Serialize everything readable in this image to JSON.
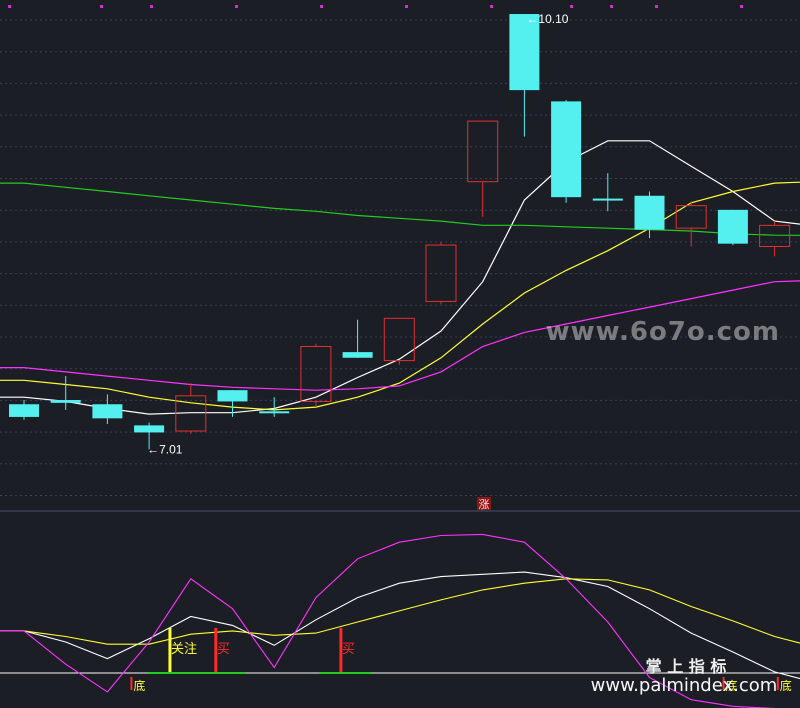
{
  "chart_data": {
    "type": "candlestick",
    "price_annotations": {
      "high_label": "10.10",
      "low_label": "7.01"
    },
    "price_panel": {
      "ylim": [
        6.7,
        10.15
      ],
      "candles": [
        {
          "open": 7.33,
          "high": 7.36,
          "low": 7.22,
          "close": 7.24
        },
        {
          "open": 7.36,
          "high": 7.53,
          "low": 7.29,
          "close": 7.34
        },
        {
          "open": 7.33,
          "high": 7.4,
          "low": 7.19,
          "close": 7.23
        },
        {
          "open": 7.18,
          "high": 7.2,
          "low": 7.01,
          "close": 7.13
        },
        {
          "open": 7.14,
          "high": 7.48,
          "low": 7.12,
          "close": 7.39
        },
        {
          "open": 7.43,
          "high": 7.43,
          "low": 7.24,
          "close": 7.35
        },
        {
          "open": 7.28,
          "high": 7.38,
          "low": 7.24,
          "close": 7.27
        },
        {
          "open": 7.35,
          "high": 7.76,
          "low": 7.31,
          "close": 7.74
        },
        {
          "open": 7.7,
          "high": 7.93,
          "low": 7.66,
          "close": 7.66
        },
        {
          "open": 7.64,
          "high": 7.94,
          "low": 7.61,
          "close": 7.94
        },
        {
          "open": 8.06,
          "high": 8.48,
          "low": 8.04,
          "close": 8.46
        },
        {
          "open": 8.91,
          "high": 9.34,
          "low": 8.66,
          "close": 9.34
        },
        {
          "open": 10.1,
          "high": 10.1,
          "low": 9.23,
          "close": 9.56
        },
        {
          "open": 9.48,
          "high": 9.49,
          "low": 8.76,
          "close": 8.8
        },
        {
          "open": 8.79,
          "high": 8.97,
          "low": 8.7,
          "close": 8.79
        },
        {
          "open": 8.81,
          "high": 8.84,
          "low": 8.51,
          "close": 8.57
        },
        {
          "open": 8.58,
          "high": 8.77,
          "low": 8.45,
          "close": 8.74
        },
        {
          "open": 8.71,
          "high": 8.71,
          "low": 8.46,
          "close": 8.47
        },
        {
          "open": 8.45,
          "high": 8.63,
          "low": 8.38,
          "close": 8.6
        }
      ],
      "moving_averages": [
        {
          "color": "#ffffff",
          "values": [
            7.38,
            7.35,
            7.3,
            7.26,
            7.27,
            7.27,
            7.3,
            7.38,
            7.52,
            7.65,
            7.85,
            8.2,
            8.78,
            9.05,
            9.2,
            9.2,
            9.02,
            8.84,
            8.63
          ]
        },
        {
          "color": "#ffff33",
          "values": [
            7.5,
            7.47,
            7.44,
            7.38,
            7.34,
            7.31,
            7.29,
            7.31,
            7.38,
            7.48,
            7.66,
            7.9,
            8.12,
            8.28,
            8.42,
            8.58,
            8.76,
            8.84,
            8.9
          ]
        },
        {
          "color": "#ff33ff",
          "values": [
            7.59,
            7.56,
            7.53,
            7.5,
            7.47,
            7.45,
            7.44,
            7.43,
            7.44,
            7.46,
            7.56,
            7.74,
            7.84,
            7.9,
            7.96,
            8.02,
            8.08,
            8.14,
            8.2
          ]
        },
        {
          "color": "#22cc22",
          "values": [
            8.9,
            8.87,
            8.84,
            8.81,
            8.78,
            8.75,
            8.72,
            8.7,
            8.67,
            8.65,
            8.63,
            8.6,
            8.6,
            8.59,
            8.58,
            8.57,
            8.56,
            8.54,
            8.53
          ]
        }
      ]
    },
    "indicator_panel": {
      "ylim": [
        -10,
        155
      ],
      "lines": [
        {
          "color": "#ffffff",
          "values": [
            55,
            45,
            30,
            48,
            68,
            60,
            42,
            65,
            85,
            98,
            104,
            106,
            108,
            103,
            95,
            75,
            53,
            36,
            18
          ]
        },
        {
          "color": "#ffff33",
          "values": [
            55,
            50,
            43,
            43,
            52,
            55,
            51,
            53,
            63,
            73,
            83,
            92,
            98,
            102,
            101,
            92,
            77,
            64,
            50
          ]
        },
        {
          "color": "#ff33ff",
          "values": [
            55,
            25,
            0,
            45,
            102,
            75,
            22,
            85,
            120,
            135,
            141,
            142,
            135,
            102,
            63,
            13,
            -7,
            -13,
            -15
          ]
        }
      ],
      "bottom_markers": [
        {
          "text": "底",
          "index": 2.6
        },
        {
          "text": "底",
          "index": 16.8
        },
        {
          "text": "底",
          "index": 18.1
        },
        {
          "text": "底",
          "index": 19.0
        }
      ],
      "signal_markers": [
        {
          "text": "关注",
          "index": 3.5,
          "color": "#ffff33"
        },
        {
          "text": "买",
          "index": 4.6,
          "color": "#ff2a2a"
        },
        {
          "text": "买",
          "index": 7.6,
          "color": "#ff2a2a"
        }
      ],
      "center_marker": "涨",
      "markers_label": [
        "底",
        "关注",
        "买",
        "买"
      ]
    },
    "grid": true,
    "legend": "none"
  },
  "watermarks": {
    "top": "www.6o7o.com",
    "bottom_cn": "掌 上 指 标",
    "bottom_url": "www.palmindex.com"
  },
  "colors": {
    "background": "#1c1e26",
    "up": "#e03030",
    "down": "#54f0f0",
    "grid": "#3a3f5a"
  }
}
